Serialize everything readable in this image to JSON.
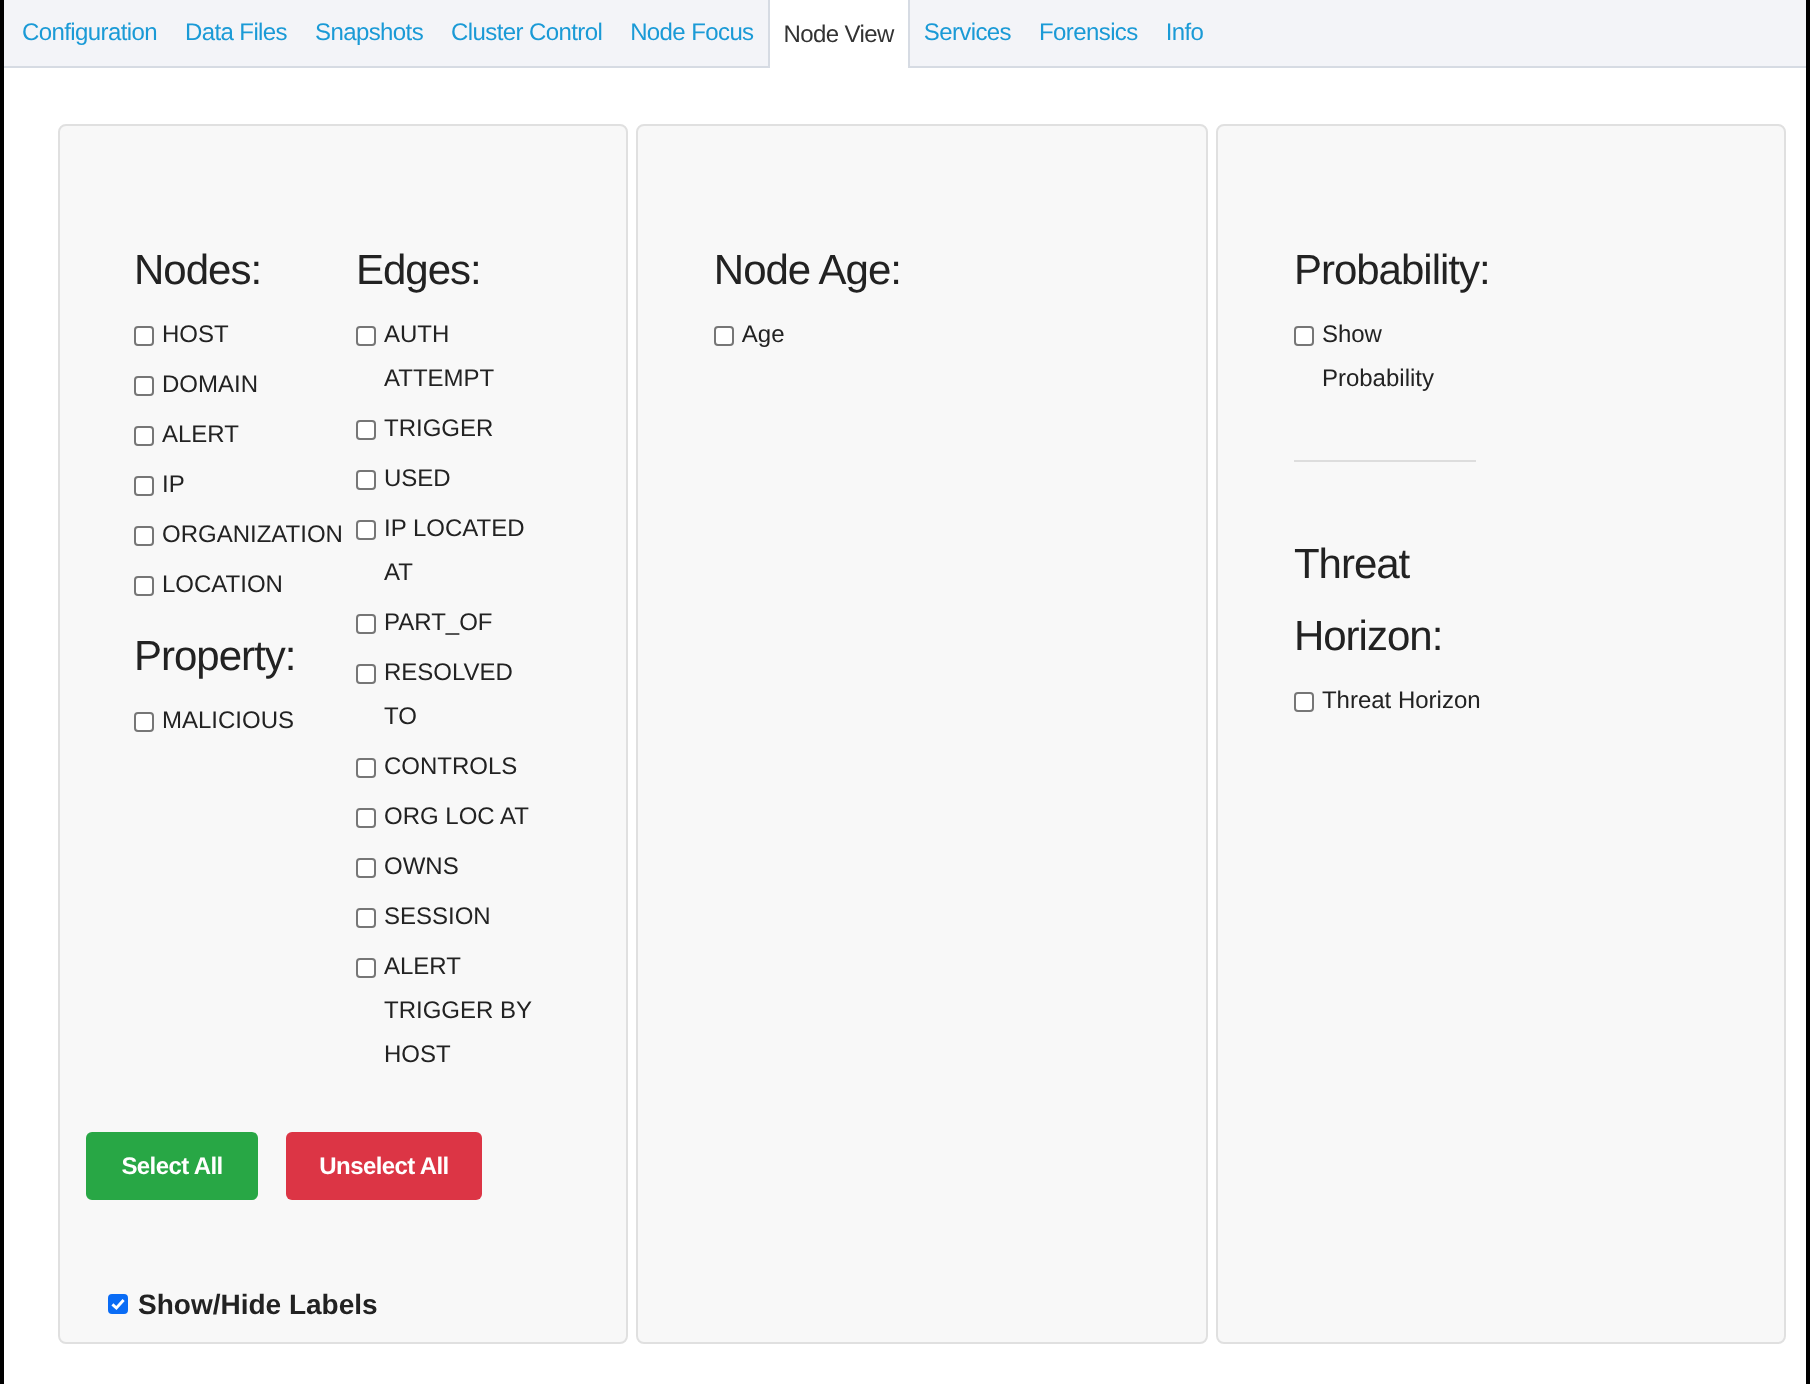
{
  "tabs": [
    {
      "label": "Configuration",
      "selected": false
    },
    {
      "label": "Data Files",
      "selected": false
    },
    {
      "label": "Snapshots",
      "selected": false
    },
    {
      "label": "Cluster Control",
      "selected": false
    },
    {
      "label": "Node Focus",
      "selected": false
    },
    {
      "label": "Node View",
      "selected": true
    },
    {
      "label": "Services",
      "selected": false
    },
    {
      "label": "Forensics",
      "selected": false
    },
    {
      "label": "Info",
      "selected": false
    }
  ],
  "filters": {
    "nodes": {
      "heading": "Nodes:",
      "items": [
        {
          "label": "HOST",
          "checked": false
        },
        {
          "label": "DOMAIN",
          "checked": false
        },
        {
          "label": "ALERT",
          "checked": false
        },
        {
          "label": "IP",
          "checked": false
        },
        {
          "label": "ORGANIZATION",
          "checked": false
        },
        {
          "label": "LOCATION",
          "checked": false
        }
      ]
    },
    "property": {
      "heading": "Property:",
      "items": [
        {
          "label": "MALICIOUS",
          "checked": false
        }
      ]
    },
    "edges": {
      "heading": "Edges:",
      "items": [
        {
          "label": "AUTH ATTEMPT",
          "checked": false
        },
        {
          "label": "TRIGGER",
          "checked": false
        },
        {
          "label": "USED",
          "checked": false
        },
        {
          "label": "IP LOCATED AT",
          "checked": false
        },
        {
          "label": "PART_OF",
          "checked": false
        },
        {
          "label": "RESOLVED TO",
          "checked": false
        },
        {
          "label": "CONTROLS",
          "checked": false
        },
        {
          "label": "ORG LOC AT",
          "checked": false
        },
        {
          "label": "OWNS",
          "checked": false
        },
        {
          "label": "SESSION",
          "checked": false
        },
        {
          "label": "ALERT TRIGGER BY HOST",
          "checked": false
        }
      ]
    },
    "buttons": [
      {
        "label": "Select All",
        "kind": "success"
      },
      {
        "label": "Unselect All",
        "kind": "danger"
      }
    ],
    "show_labels": {
      "label": "Show/Hide Labels",
      "checked": true
    }
  },
  "node_age": {
    "heading": "Node Age:",
    "items": [
      {
        "label": "Age",
        "checked": false
      }
    ]
  },
  "probability": {
    "heading": "Probability:",
    "items": [
      {
        "label": "Show Probability",
        "checked": false
      }
    ]
  },
  "threat_horizon": {
    "heading": "Threat Horizon:",
    "items": [
      {
        "label": "Threat Horizon",
        "checked": false
      }
    ]
  }
}
